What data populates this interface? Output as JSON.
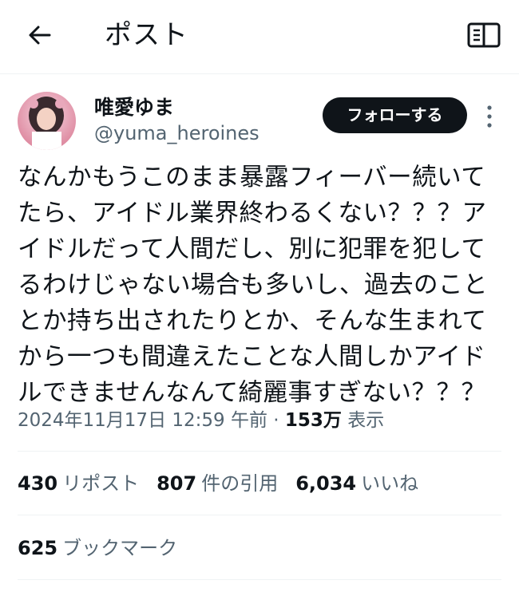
{
  "header": {
    "title": "ポスト",
    "back_icon": "arrow-left-icon",
    "reader_icon": "book-open-icon"
  },
  "author": {
    "name": "唯愛ゆま",
    "handle": "@yuma_heroines",
    "follow_label": "フォローする",
    "more_icon": "more-vertical-icon"
  },
  "tweet": {
    "text": "なんかもうこのまま暴露フィーバー続いて\nたら、アイドル業界終わるくない？？？ア\nイドルだって人間だし、別に犯罪を犯して\nるわけじゃない場合も多いし、過去のこと\nとか持ち出されたりとか、そんな生まれて\nから一つも間違えたことな人間しかアイド\nルできませんなんて綺麗事すぎない？？？",
    "timestamp": "2024年11月17日 12:59 午前",
    "separator": " · ",
    "views_count": "153万",
    "views_label": "表示"
  },
  "stats": [
    {
      "count": "430",
      "label": "リポスト"
    },
    {
      "count": "807",
      "label": "件の引用"
    },
    {
      "count": "6,034",
      "label": "いいね"
    }
  ],
  "bookmarks": {
    "count": "625",
    "label": "ブックマーク"
  },
  "colors": {
    "text": "#0f1419",
    "secondary": "#536471",
    "divider": "#eff3f4",
    "button_bg": "#0f1419"
  }
}
